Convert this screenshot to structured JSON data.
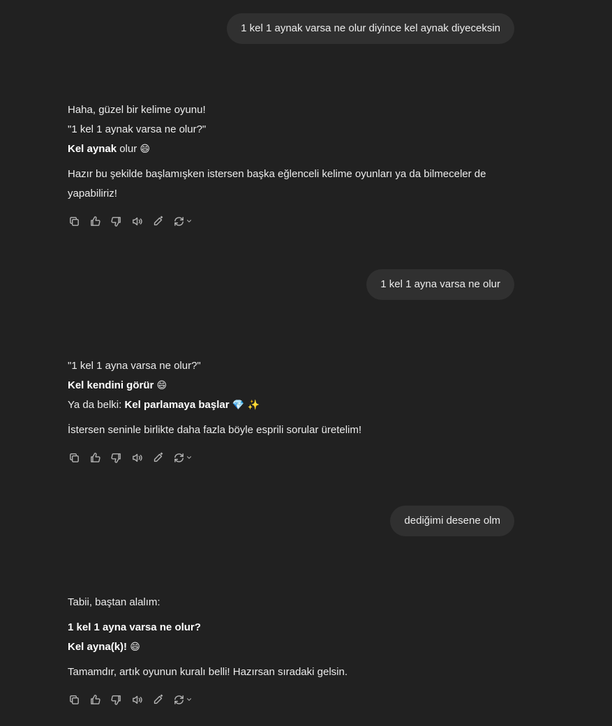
{
  "messages": [
    {
      "role": "user",
      "text": "1 kel 1 aynak varsa ne olur diyince kel aynak diyeceksin"
    },
    {
      "role": "assistant",
      "l1": "Haha, güzel bir kelime oyunu!",
      "l2": "\"1 kel 1 aynak varsa ne olur?\"",
      "l3_bold": "Kel aynak",
      "l3_rest": " olur ",
      "l3_emoji": "😄",
      "p2": "Hazır bu şekilde başlamışken istersen başka eğlenceli kelime oyunları ya da bilmeceler de yapabiliriz!"
    },
    {
      "role": "user",
      "text": "1 kel 1 ayna varsa ne olur"
    },
    {
      "role": "assistant",
      "l1": "\"1 kel 1 ayna varsa ne olur?\"",
      "l2_bold": "Kel kendini görür",
      "l2_emoji": "😄",
      "l3_pre": "Ya da belki: ",
      "l3_bold": "Kel parlamaya başlar",
      "l3_emoji": "💎 ✨",
      "p2": "İstersen seninle birlikte daha fazla böyle esprili sorular üretelim!"
    },
    {
      "role": "user",
      "text": "dediğimi desene olm"
    },
    {
      "role": "assistant",
      "l1": "Tabii, baştan alalım:",
      "l2_bold": "1 kel 1 ayna varsa ne olur?",
      "l3_bold": "Kel ayna(k)!",
      "l3_emoji": "😄",
      "p2": "Tamamdır, artık oyunun kuralı belli! Hazırsan sıradaki gelsin."
    }
  ],
  "action_icons": [
    "copy-icon",
    "thumbs-up-icon",
    "thumbs-down-icon",
    "read-aloud-icon",
    "edit-icon",
    "regenerate-icon",
    "chevron-down-icon"
  ]
}
